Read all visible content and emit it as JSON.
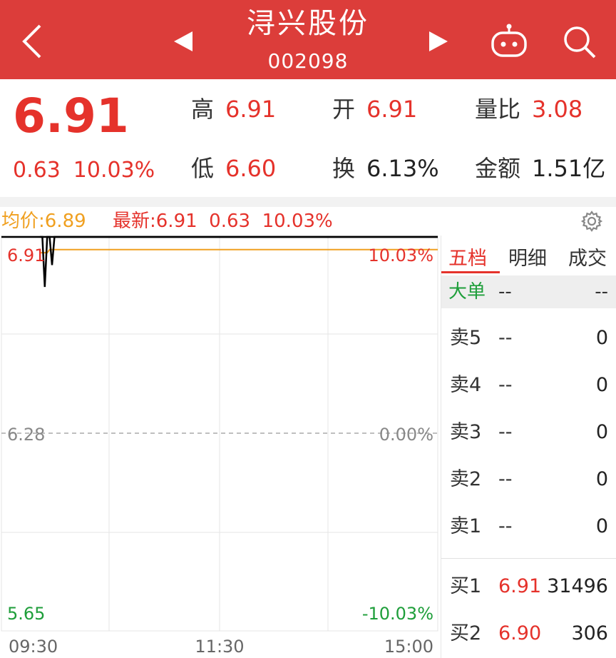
{
  "header": {
    "stock_name": "浔兴股份",
    "stock_code": "002098",
    "icons": [
      "back-icon",
      "prev-triangle-icon",
      "next-triangle-icon",
      "robot-icon",
      "search-icon"
    ],
    "color": "#dc3d3a"
  },
  "quote": {
    "price": "6.91",
    "change": "0.63",
    "change_pct": "10.03%",
    "high_label": "高",
    "high_value": "6.91",
    "open_label": "开",
    "open_value": "6.91",
    "vol_ratio_label": "量比",
    "vol_ratio_value": "3.08",
    "low_label": "低",
    "low_value": "6.60",
    "turnover_label": "换",
    "turnover_value": "6.13%",
    "amount_label": "金额",
    "amount_value": "1.51亿"
  },
  "chart_header": {
    "avg_label": "均价:6.89",
    "latest_label": "最新:6.91  0.63  10.03%"
  },
  "chart": {
    "y_left_top": "6.91",
    "y_left_mid": "6.28",
    "y_left_bottom": "5.65",
    "y_right_top": "10.03%",
    "y_right_mid": "0.00%",
    "y_right_bottom": "-10.03%",
    "x_start": "09:30",
    "x_mid": "11:30",
    "x_end": "15:00",
    "colors": {
      "price_line": "#000000",
      "avg_line": "#f0a020",
      "up": "#e5322b",
      "down": "#1e9e3a"
    }
  },
  "chart_data": {
    "type": "line",
    "ylim": [
      5.65,
      6.91
    ],
    "series": [
      {
        "values": [
          6.91,
          6.91,
          6.75,
          6.91,
          6.91,
          6.82,
          6.91,
          6.91
        ]
      },
      {
        "values": [
          6.88,
          6.88,
          6.88,
          6.88,
          6.89,
          6.89,
          6.89,
          6.89
        ]
      }
    ]
  },
  "panel": {
    "tabs": [
      "五档",
      "明细",
      "成交"
    ],
    "big_order": {
      "label": "大单",
      "mid": "--",
      "right": "--"
    },
    "sell": [
      {
        "label": "卖5",
        "price": "--",
        "vol": "0"
      },
      {
        "label": "卖4",
        "price": "--",
        "vol": "0"
      },
      {
        "label": "卖3",
        "price": "--",
        "vol": "0"
      },
      {
        "label": "卖2",
        "price": "--",
        "vol": "0"
      },
      {
        "label": "卖1",
        "price": "--",
        "vol": "0"
      }
    ],
    "buy": [
      {
        "label": "买1",
        "price": "6.91",
        "vol": "31496"
      },
      {
        "label": "买2",
        "price": "6.90",
        "vol": "306"
      }
    ]
  }
}
